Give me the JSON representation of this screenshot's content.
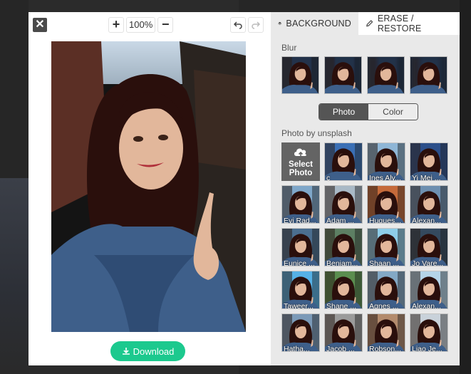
{
  "toolbar": {
    "close_glyph": "✕",
    "zoom_in_glyph": "+",
    "zoom_out_glyph": "−",
    "zoom_level": "100%"
  },
  "download": {
    "label": "Download"
  },
  "tabs": [
    {
      "label": "BACKGROUND",
      "icon": "layers-icon"
    },
    {
      "label": "ERASE / RESTORE",
      "icon": "pencil-icon"
    }
  ],
  "blur": {
    "label": "Blur",
    "levels": [
      {
        "blur": 0
      },
      {
        "blur": 1
      },
      {
        "blur": 2
      },
      {
        "blur": 3
      }
    ]
  },
  "mode_toggle": {
    "options": [
      "Photo",
      "Color"
    ],
    "selected": "Photo"
  },
  "photos": {
    "label": "Photo by unsplash",
    "select_label": "Select Photo",
    "items": [
      {
        "caption": "c",
        "bg": "#3a6fb5"
      },
      {
        "caption": "Ines Alv...",
        "bg": "#8fb6d6"
      },
      {
        "caption": "Yi Mei ...",
        "bg": "#2c4f8a"
      },
      {
        "caption": "Evi Rad...",
        "bg": "#7fa7c9"
      },
      {
        "caption": "Adam ...",
        "bg": "#a9b9c6"
      },
      {
        "caption": "Hugues...",
        "bg": "#c56a3a"
      },
      {
        "caption": "Alexan...",
        "bg": "#6d8fb0"
      },
      {
        "caption": "Eunice ...",
        "bg": "#4b6e8f"
      },
      {
        "caption": "Benjam...",
        "bg": "#5d7f63"
      },
      {
        "caption": "Shaan ...",
        "bg": "#8ecde8"
      },
      {
        "caption": "Jo Vare...",
        "bg": "#34495e"
      },
      {
        "caption": "Taweer...",
        "bg": "#56b1e6"
      },
      {
        "caption": "Shane ...",
        "bg": "#5a8d4f"
      },
      {
        "caption": "Agnes ...",
        "bg": "#83a8c5"
      },
      {
        "caption": "Alexan...",
        "bg": "#b5d4e8"
      },
      {
        "caption": "Hatha...",
        "bg": "#7b9ab8"
      },
      {
        "caption": "Jacob ...",
        "bg": "#9b9b9b"
      },
      {
        "caption": "Robson...",
        "bg": "#b38b6d"
      },
      {
        "caption": "Liao Je...",
        "bg": "#c9d2da"
      }
    ]
  },
  "colors": {
    "accent_green": "#1cc98e",
    "panel_bg": "#e9e9e9",
    "toggle_active": "#555555"
  }
}
